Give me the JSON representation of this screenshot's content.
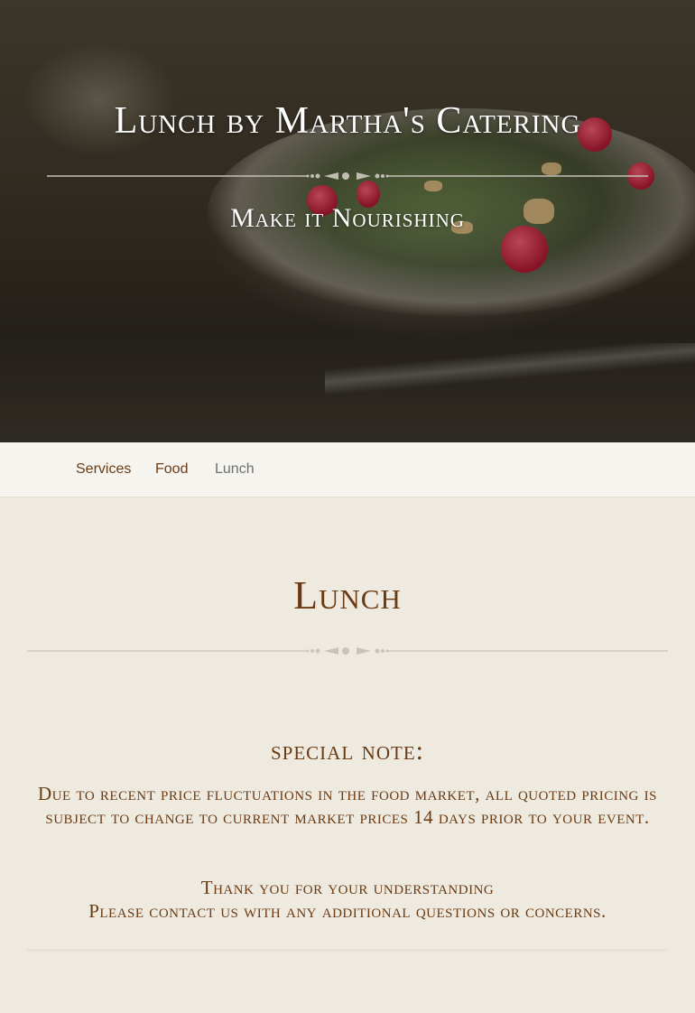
{
  "hero": {
    "icon": "utensils-icon",
    "icon_glyph": "",
    "title": "Lunch by Martha's Catering",
    "subtitle": "Make it Nourishing"
  },
  "breadcrumb": {
    "home_icon": "home-icon",
    "home_glyph": "",
    "separator_glyph": "",
    "items": [
      "Services",
      "Food",
      "Lunch"
    ]
  },
  "main": {
    "title": "Lunch",
    "note_icon": "info-icon",
    "note_glyph": "",
    "note_heading": "special note:",
    "note_body": "Due to recent price fluctuations in the food market, all quoted pricing is subject to change to current market prices 14 days prior to your event.",
    "note_thanks_1": "Thank you for your understanding",
    "note_thanks_2": "Please contact us with any additional questions or concerns.",
    "bottom_icon": "section-icon",
    "bottom_glyph": ""
  },
  "colors": {
    "accent": "#6b3a12",
    "background": "#efeae0",
    "breadcrumb_bg": "#f6f4ee"
  }
}
